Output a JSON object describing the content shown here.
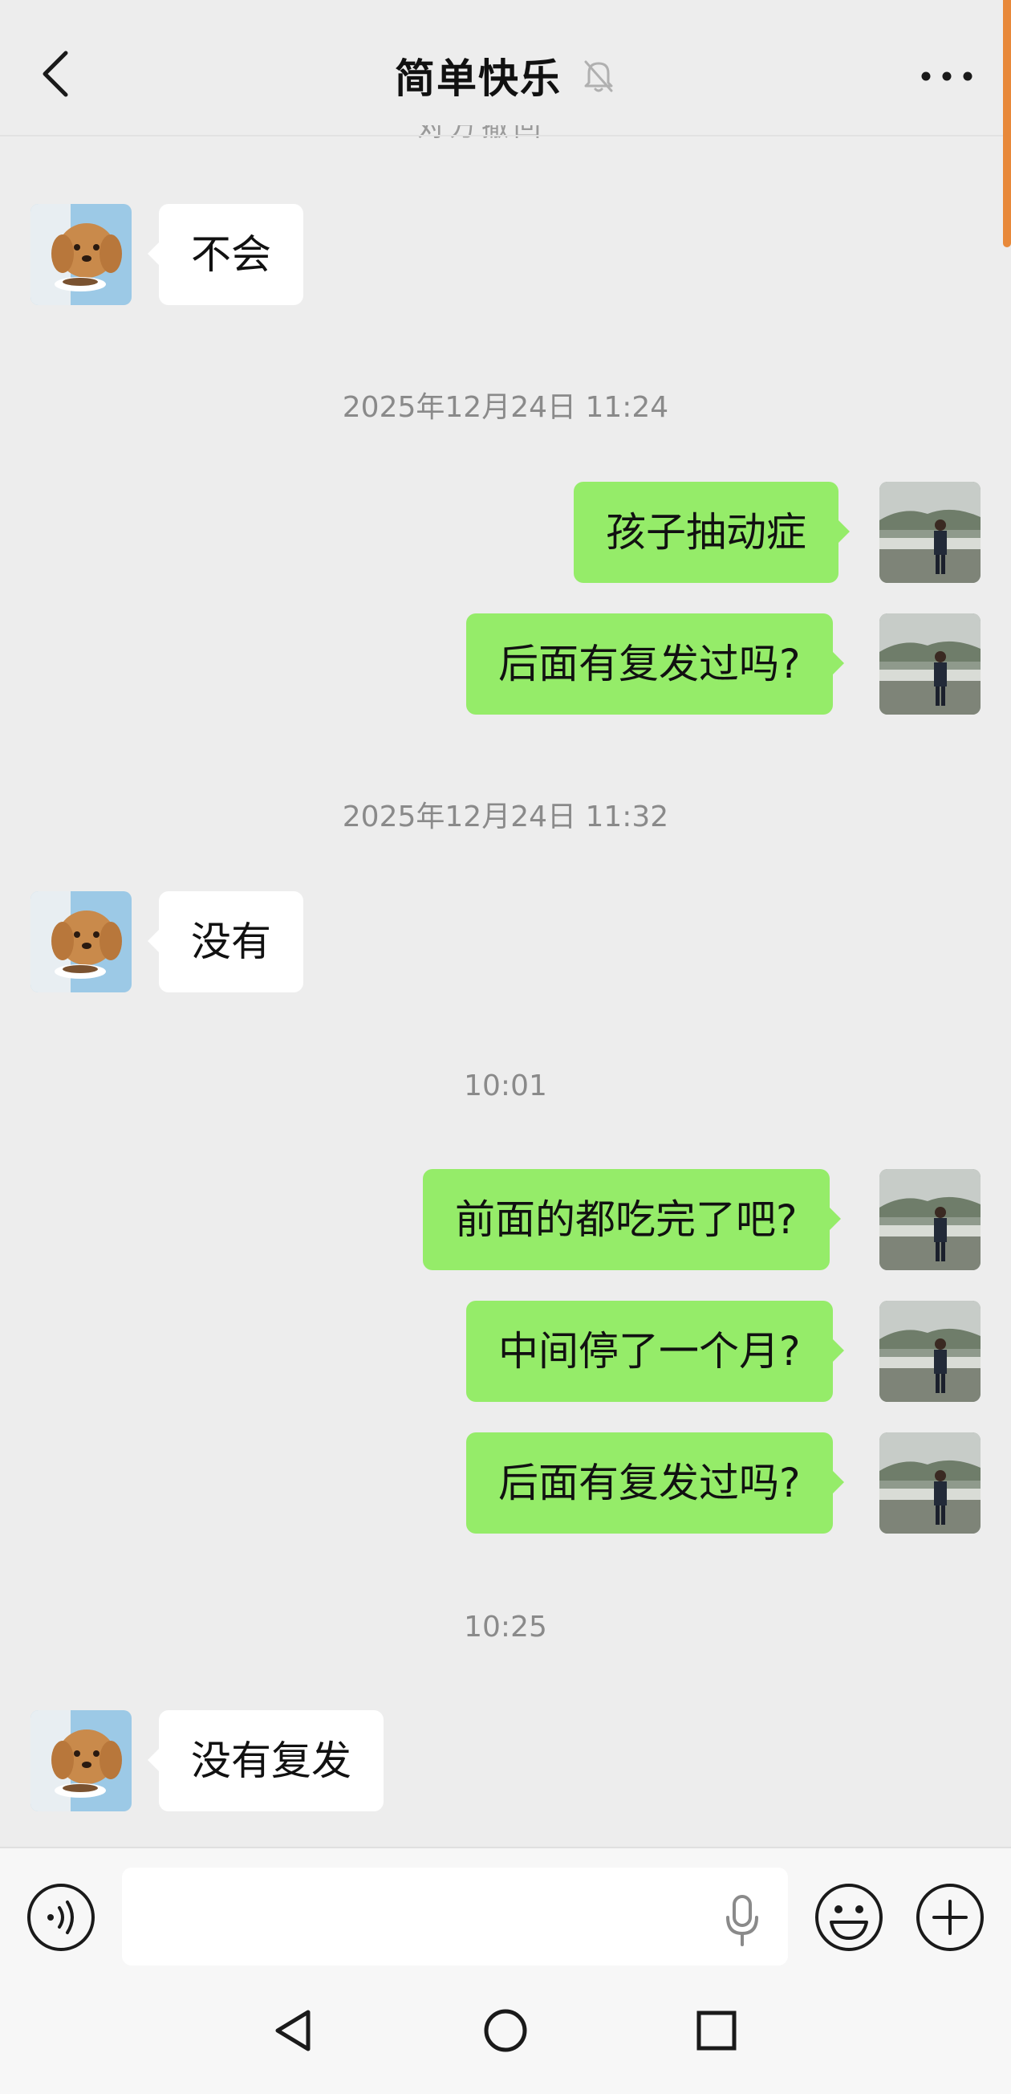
{
  "header": {
    "title": "简单快乐",
    "icons": {
      "back": "chevron-left-icon",
      "mute": "bell-off-icon",
      "more": "more-dots-icon"
    }
  },
  "cut_off_text": "对方撤回",
  "messages": [
    {
      "side": "left",
      "text": "不会"
    },
    {
      "timestamp": "2025年12月24日 11:24"
    },
    {
      "side": "right",
      "text": "孩子抽动症"
    },
    {
      "side": "right",
      "text": "后面有复发过吗?"
    },
    {
      "timestamp": "2025年12月24日 11:32"
    },
    {
      "side": "left",
      "text": "没有"
    },
    {
      "timestamp": "10:01"
    },
    {
      "side": "right",
      "text": "前面的都吃完了吧?"
    },
    {
      "side": "right",
      "text": "中间停了一个月?"
    },
    {
      "side": "right",
      "text": "后面有复发过吗?"
    },
    {
      "timestamp": "10:25"
    },
    {
      "side": "left",
      "text": "没有复发"
    }
  ],
  "input_bar": {
    "value": "",
    "placeholder": "",
    "icons": {
      "voice": "voice-icon",
      "mic": "mic-icon",
      "emoji": "emoji-icon",
      "plus": "plus-icon"
    }
  },
  "nav_bar": {
    "icons": [
      "back-triangle-icon",
      "home-circle-icon",
      "recents-square-icon"
    ]
  },
  "colors": {
    "background": "#ededed",
    "own_bubble": "#95ec69",
    "other_bubble": "#ffffff",
    "timestamp": "#8a8a8a",
    "scroll_indicator": "#e8893a"
  }
}
